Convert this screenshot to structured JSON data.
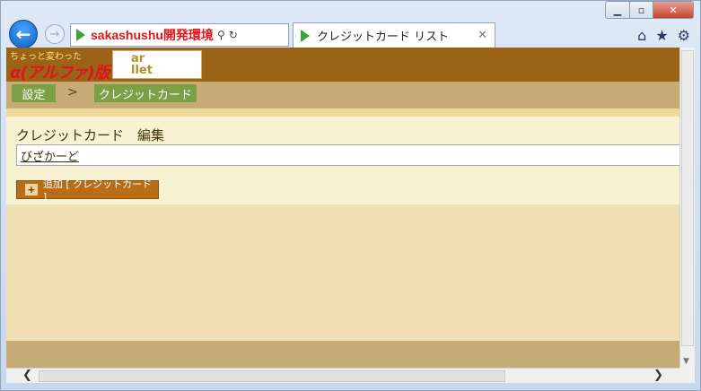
{
  "browser": {
    "address_text": "sakashushu開発環境",
    "tab_title": "クレジットカード リスト",
    "window_controls": [
      "minimize-icon",
      "maximize-icon",
      "close-icon"
    ],
    "toolbar_icons": [
      "home-icon",
      "star-icon",
      "gear-icon"
    ]
  },
  "site": {
    "logo_small_text": "ちょっと変わった",
    "logo_main_text": "α(アルファ)版"
  },
  "breadcrumb": {
    "item1": "設定",
    "separator": ">",
    "item2": "クレジットカード"
  },
  "main": {
    "title": "クレジットカード　編集",
    "items": [
      {
        "label": "びざかーど"
      }
    ],
    "add_button_label": "追加 [ クレジットカード ]"
  },
  "colors": {
    "header_brown": "#9b6316",
    "crumb_green": "#7ba046",
    "band_tan": "#c7ab74",
    "button_orange": "#b86d17"
  }
}
